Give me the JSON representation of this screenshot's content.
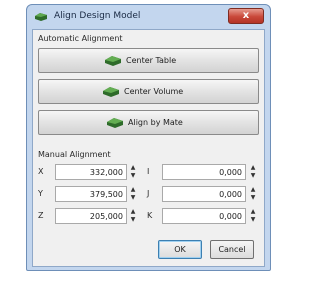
{
  "window": {
    "title": "Align Design Model",
    "close_symbol": "x",
    "colors": {
      "frame": "#c3d6ee",
      "close": "#c9483a",
      "icon_green": "#2e6b2a"
    }
  },
  "automatic": {
    "label": "Automatic Alignment",
    "buttons": [
      {
        "label": "Center Table",
        "icon": "model-icon"
      },
      {
        "label": "Center Volume",
        "icon": "model-icon"
      },
      {
        "label": "Align by Mate",
        "icon": "model-icon"
      }
    ]
  },
  "manual": {
    "label": "Manual Alignment",
    "fields": [
      {
        "label": "X",
        "value": "332,000"
      },
      {
        "label": "Y",
        "value": "379,500"
      },
      {
        "label": "Z",
        "value": "205,000"
      },
      {
        "label": "I",
        "value": "0,000"
      },
      {
        "label": "J",
        "value": "0,000"
      },
      {
        "label": "K",
        "value": "0,000"
      }
    ],
    "spin_up": "▲",
    "spin_down": "▼"
  },
  "footer": {
    "ok_label": "OK",
    "cancel_label": "Cancel"
  }
}
